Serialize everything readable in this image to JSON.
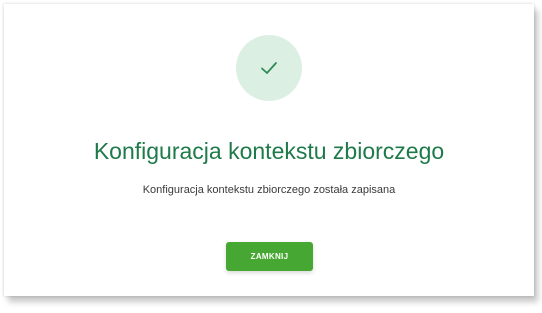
{
  "dialog": {
    "icon": "check-icon",
    "title": "Konfiguracja kontekstu zbiorczego",
    "message": "Konfiguracja kontekstu zbiorczego została zapisana",
    "close_label": "ZAMKNIJ"
  },
  "colors": {
    "title": "#1f7a4a",
    "icon_circle": "#dcefe3",
    "icon_check": "#2e8b57",
    "button": "#46a832"
  }
}
